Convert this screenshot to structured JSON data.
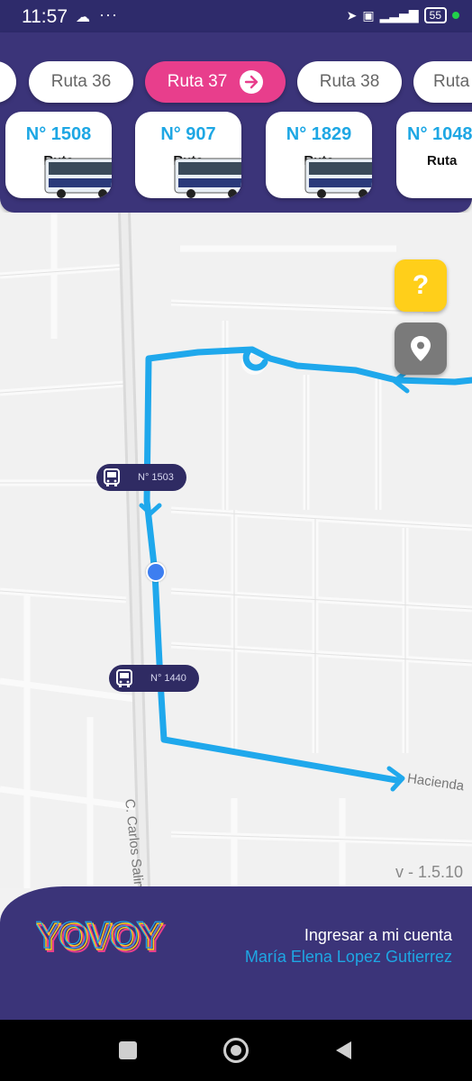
{
  "status_bar": {
    "time": "11:57",
    "battery": "55"
  },
  "routes": [
    {
      "label": ""
    },
    {
      "label": "Ruta 36"
    },
    {
      "label": "Ruta 37",
      "active": true
    },
    {
      "label": "Ruta 38"
    },
    {
      "label": "Ruta"
    }
  ],
  "buses": [
    {
      "number": "N° 1508",
      "label": "Ruta"
    },
    {
      "number": "N° 907",
      "label": "Ruta"
    },
    {
      "number": "N° 1829",
      "label": "Ruta"
    },
    {
      "number": "N° 1048",
      "label": "Ruta"
    }
  ],
  "map": {
    "bus_markers": [
      {
        "number": "N° 1503"
      },
      {
        "number": "N° 1440"
      }
    ],
    "street_left": "C. Carlos Salinas de",
    "street_right": "Hacienda",
    "route_color": "#1fa8ec"
  },
  "version": "v - 1.5.10",
  "footer": {
    "logo_text": "YOVOY",
    "cta": "Ingresar a mi cuenta",
    "user_name": "María Elena Lopez Gutierrez"
  },
  "colors": {
    "brand": "#3b3479",
    "accent": "#e83e8c",
    "cyan": "#1ea7e4",
    "help": "#ffcf1a"
  }
}
